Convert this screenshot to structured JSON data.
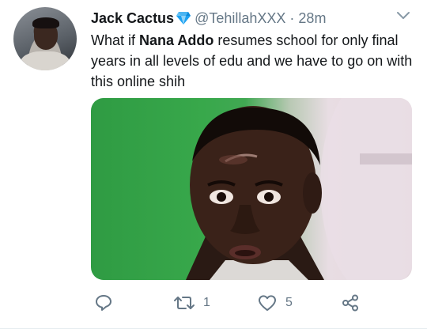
{
  "tweet": {
    "author_name": "Jack Cactus",
    "handle": "@TehillahXXX",
    "separator": "·",
    "time": "28m",
    "text_part1": "What if ",
    "text_bold": "Nana Addo",
    "text_part2": " resumes school for only final years in all levels of edu and we have to go on with this online shih"
  },
  "actions": {
    "reply_count": "",
    "retweet_count": "1",
    "like_count": "5"
  },
  "icons": {
    "verified": "gem-icon",
    "caret": "chevron-down-icon",
    "reply": "reply-icon",
    "retweet": "retweet-icon",
    "like": "heart-icon",
    "share": "share-icon"
  },
  "colors": {
    "secondary_text": "#657786",
    "verified_gem": "#1da1f2"
  }
}
